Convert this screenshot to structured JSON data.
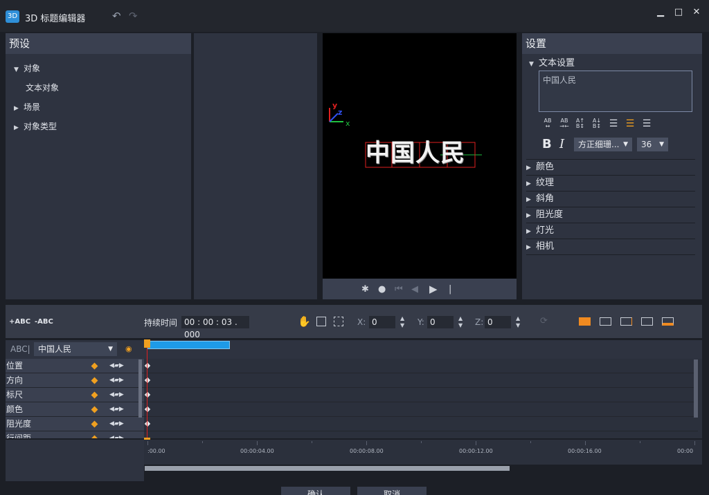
{
  "app": {
    "logo": "3D",
    "title": "3D 标题编辑器"
  },
  "icons": {
    "undo": "undo-icon",
    "redo": "redo-icon"
  },
  "window": {
    "minimize": "▁",
    "maximize": "□",
    "close": "✕"
  },
  "preset": {
    "header": "预设",
    "items": [
      {
        "label": "对象",
        "arrow": "▼"
      },
      {
        "label": "文本对象",
        "arrow": ""
      },
      {
        "label": "场景",
        "arrow": "▶"
      },
      {
        "label": "对象类型",
        "arrow": "▶"
      }
    ]
  },
  "preview": {
    "text": "中国人民",
    "axis_x": "x",
    "axis_y": "y",
    "axis_z": "z"
  },
  "settings": {
    "header": "设置",
    "text_section": "文本设置",
    "text_value": "中国人民",
    "bold": "B",
    "italic": "I",
    "font": "方正细珊...",
    "size": "36",
    "sections": [
      "颜色",
      "纹理",
      "斜角",
      "阻光度",
      "灯光",
      "相机"
    ]
  },
  "timeline": {
    "add_text": "+ABC",
    "remove_text": "-ABC",
    "duration_label": "持续时间",
    "duration_value": "00 : 00 : 03 . 000",
    "x_label": "X:",
    "x_value": "0",
    "y_label": "Y:",
    "y_value": "0",
    "z_label": "Z:",
    "z_value": "0",
    "object_prefix": "ABC|",
    "object_selected": "中国人民",
    "tracks": [
      "位置",
      "方向",
      "标尺",
      "颜色",
      "阻光度",
      "行间距"
    ],
    "ruler": [
      ":00.00",
      "00:00:04.00",
      "00:00:08.00",
      "00:00:12.00",
      "00:00:16.00",
      "00:00"
    ]
  },
  "buttons": {
    "ok": "确认",
    "cancel": "取消"
  },
  "colors": {
    "accent": "#2f8fd8",
    "keyframe": "#f0a020",
    "clip": "#1e9be8",
    "playhead": "#e02020"
  }
}
